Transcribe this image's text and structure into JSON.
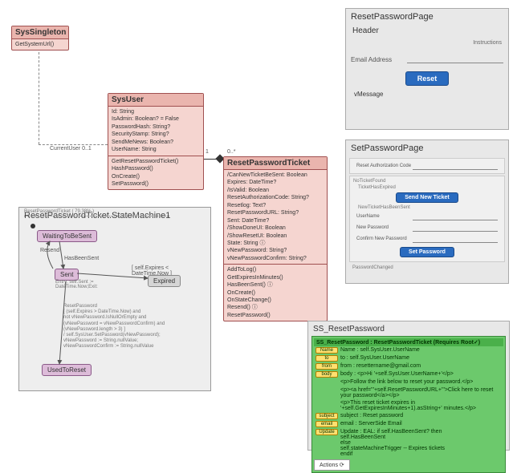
{
  "sysSingleton": {
    "title": "SysSingleton",
    "method": "GetSystemUrl()"
  },
  "sysUser": {
    "title": "SysUser",
    "attrs": [
      "Id: String",
      "IsAdmin: Boolean? = False",
      "PasswordHash: String?",
      "SecurityStamp: String?",
      "SendMeNews: Boolean?",
      "UserName: String"
    ],
    "ops": [
      "GetResetPasswordTicket()",
      "HashPassword()",
      "OnCreate()",
      "SetPassword()"
    ]
  },
  "assoc": {
    "currentUser": "CurrentUser 0..1",
    "one": "1",
    "many": "0..*"
  },
  "resetTicket": {
    "title": "ResetPasswordTicket",
    "attrs": [
      "/CanNewTicketBeSent: Boolean",
      "Expires: DateTime?",
      "/IsValid: Boolean",
      "ResetAuthorizationCode: String?",
      "Resetlog: Text?",
      "ResetPasswordURL: String?",
      "Sent: DateTime?",
      "/ShowDoneUI: Boolean",
      "/ShowResetUI: Boolean",
      "State: String ⓘ",
      "vNewPassword: String?",
      "vNewPasswordConfirm: String?"
    ],
    "ops": [
      "AddToLog()",
      "GetExpiresInMinutes()",
      "HasBeenSent() ⓘ",
      "OnCreate()",
      "OnStateChange()",
      "Resend() ⓘ",
      "ResetPassword()"
    ]
  },
  "stateMachine": {
    "title": "ResetPasswordTicket.StateMachine1",
    "tiny": "ResetPasswordTicket ( 79.38% )",
    "states": {
      "waiting": "WaitingToBeSent",
      "sent": "Sent",
      "expired": "Expired",
      "used": "UsedToReset"
    },
    "trans": {
      "hasBeenSent": "HasBeenSent",
      "resend": "Resend",
      "expireGuard": "[ self.Expires < DateTime.Now ]",
      "sentEntry": "Entry: self.Sent := DateTime.Now;Exit:",
      "resetPasswordGuard": "ResetPassword\n[ (self.Expires > DateTime.Now) and\nnot vNewPassword.IsNullOrEmpty and\n(vNewPassword = vNewPasswordConfirm) and\n(vNewPassword.length > 3) ]\n/ self.SysUser.SetPassword(vNewPassword);\nvNewPassword := String.nullValue;\nvNewPasswordConfirm := String.nullValue"
    }
  },
  "resetPage": {
    "title": "ResetPasswordPage",
    "header": "Header",
    "instructions": "Instructions",
    "email": "Email Address",
    "btn": "Reset",
    "msg": "vMessage"
  },
  "setPage": {
    "title": "SetPasswordPage",
    "labels": {
      "auth": "Reset Authorization Code",
      "noTicket": "NoTicketFound",
      "expired": "TicketHasExpired",
      "sendNew": "Send New Ticket",
      "newTicket": "NewTicketHasBeenSent",
      "user": "UserName",
      "newPw": "New Password",
      "confirm": "Confirm New Password",
      "setBtn": "Set Password",
      "changed": "PasswordChanged"
    }
  },
  "ssReset": {
    "panelTitle": "SS_ResetPassword",
    "heading": "SS_ResetPassword : ResetPasswordTicket  (Requires Root✓)",
    "name": "Name : self.SysUser.UserName",
    "to": "to : self.SysUser.UserName",
    "from": "from : resettername@gmail.com",
    "body1": "body : <p>Hi '+self.SysUser.UserName+'</p>",
    "body2": "<p>Follow the link below to reset your password.</p>",
    "body3": "<p><a href=\"'+self.ResetPasswordURL+'\">Click here to reset your password</a></p>",
    "body4": "<p>This reset ticket expires in '+self.GetExpiresInMinutes+1).asString+' minutes.</p>",
    "subject": "subject : Reset password",
    "email": "email : ServerSide Email",
    "update": "Update : EAL: if self.HasBeenSent? then\n           self.HasBeenSent\n         else\n           self.stateMachineTrigger -- Expires tickets\n         endif",
    "actions": "Actions"
  }
}
